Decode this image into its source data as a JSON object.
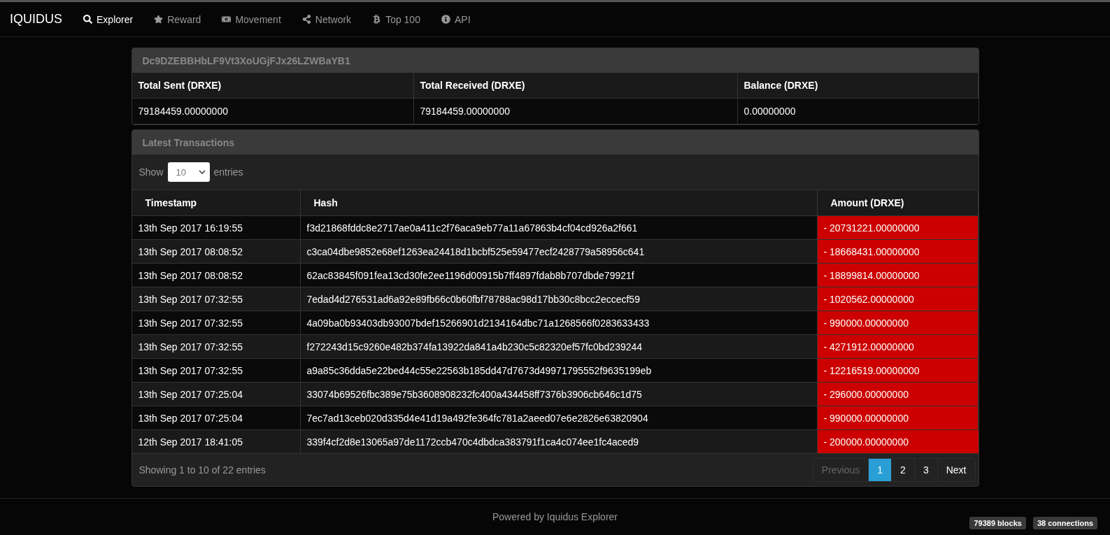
{
  "navbar": {
    "brand": "IQUIDUS",
    "items": [
      {
        "label": "Explorer",
        "selected": true
      },
      {
        "label": "Reward",
        "selected": false
      },
      {
        "label": "Movement",
        "selected": false
      },
      {
        "label": "Network",
        "selected": false
      },
      {
        "label": "Top 100",
        "selected": false
      },
      {
        "label": "API",
        "selected": false
      }
    ]
  },
  "address_panel": {
    "title": "Dc9DZEBBHbLF9Vt3XoUGjFJx26LZWBaYB1",
    "columns": [
      "Total Sent (DRXE)",
      "Total Received (DRXE)",
      "Balance (DRXE)"
    ],
    "values": [
      "79184459.00000000",
      "79184459.00000000",
      "0.00000000"
    ]
  },
  "transactions_panel": {
    "title": "Latest Transactions",
    "length_menu": {
      "before": "Show",
      "value": "10",
      "after": "entries"
    },
    "columns": [
      "Timestamp",
      "Hash",
      "Amount (DRXE)"
    ],
    "rows": [
      {
        "timestamp": "13th Sep 2017 16:19:55",
        "hash": "f3d21868fddc8e2717ae0a411c2f76aca9eb77a11a67863b4cf04cd926a2f661",
        "amount": "- 20731221.00000000",
        "kind": "sent"
      },
      {
        "timestamp": "13th Sep 2017 08:08:52",
        "hash": "c3ca04dbe9852e68ef1263ea24418d1bcbf525e59477ecf2428779a58956c641",
        "amount": "- 18668431.00000000",
        "kind": "sent"
      },
      {
        "timestamp": "13th Sep 2017 08:08:52",
        "hash": "62ac83845f091fea13cd30fe2ee1196d00915b7ff4897fdab8b707dbde79921f",
        "amount": "- 18899814.00000000",
        "kind": "sent"
      },
      {
        "timestamp": "13th Sep 2017 07:32:55",
        "hash": "7edad4d276531ad6a92e89fb66c0b60fbf78788ac98d17bb30c8bcc2eccecf59",
        "amount": "- 1020562.00000000",
        "kind": "sent"
      },
      {
        "timestamp": "13th Sep 2017 07:32:55",
        "hash": "4a09ba0b93403db93007bdef15266901d2134164dbc71a1268566f0283633433",
        "amount": "- 990000.00000000",
        "kind": "sent"
      },
      {
        "timestamp": "13th Sep 2017 07:32:55",
        "hash": "f272243d15c9260e482b374fa13922da841a4b230c5c82320ef57fc0bd239244",
        "amount": "- 4271912.00000000",
        "kind": "sent"
      },
      {
        "timestamp": "13th Sep 2017 07:32:55",
        "hash": "a9a85c36dda5e22bed44c55e22563b185dd47d7673d49971795552f9635199eb",
        "amount": "- 12216519.00000000",
        "kind": "sent"
      },
      {
        "timestamp": "13th Sep 2017 07:25:04",
        "hash": "33074b69526fbc389e75b3608908232fc400a434458ff7376b3906cb646c1d75",
        "amount": "- 296000.00000000",
        "kind": "sent"
      },
      {
        "timestamp": "13th Sep 2017 07:25:04",
        "hash": "7ec7ad13ceb020d335d4e41d19a492fe364fc781a2aeed07e6e2826e63820904",
        "amount": "- 990000.00000000",
        "kind": "sent"
      },
      {
        "timestamp": "12th Sep 2017 18:41:05",
        "hash": "339f4cf2d8e13065a97de1172ccb470c4dbdca383791f1ca4c074ee1fc4aced9",
        "amount": "- 200000.00000000",
        "kind": "sent"
      }
    ],
    "info": "Showing 1 to 10 of 22 entries",
    "pagination": [
      {
        "label": "Previous",
        "selected": false,
        "disabled": true
      },
      {
        "label": "1",
        "selected": true,
        "disabled": false
      },
      {
        "label": "2",
        "selected": false,
        "disabled": false
      },
      {
        "label": "3",
        "selected": false,
        "disabled": false
      },
      {
        "label": "Next",
        "selected": false,
        "disabled": false
      }
    ]
  },
  "footer": {
    "text": "Powered by Iquidus Explorer",
    "badges": [
      "79389 blocks",
      "38 connections"
    ]
  }
}
